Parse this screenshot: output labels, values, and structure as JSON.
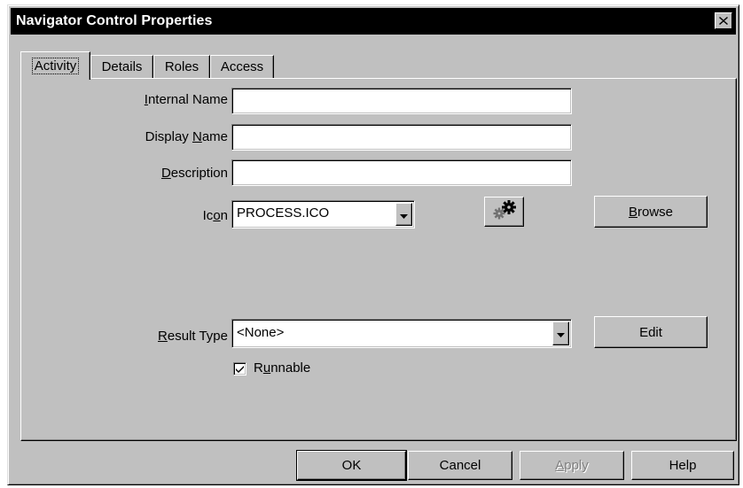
{
  "window": {
    "title": "Navigator Control Properties"
  },
  "tabs": [
    {
      "label": "Activity",
      "active": true
    },
    {
      "label": "Details",
      "active": false
    },
    {
      "label": "Roles",
      "active": false
    },
    {
      "label": "Access",
      "active": false
    }
  ],
  "form": {
    "internal_name": {
      "label": "Internal Name",
      "mnemonic": "I",
      "rest": "nternal Name",
      "value": ""
    },
    "display_name": {
      "label": "Display Name",
      "pre": "Display ",
      "mnemonic": "N",
      "rest": "ame",
      "value": ""
    },
    "description": {
      "label": "Description",
      "mnemonic": "D",
      "rest": "escription",
      "value": ""
    },
    "icon": {
      "label": "Icon",
      "pre": "Ic",
      "mnemonic": "o",
      "rest": "n",
      "value": "PROCESS.ICO"
    },
    "browse_button": {
      "label": "Browse",
      "mnemonic": "B",
      "rest": "rowse"
    },
    "result_type": {
      "label": "Result Type",
      "mnemonic": "R",
      "rest": "esult Type",
      "value": "<None>"
    },
    "edit_button": {
      "label": "Edit"
    },
    "runnable": {
      "label": "Runnable",
      "pre": "R",
      "mnemonic": "u",
      "rest": "nnable",
      "checked": true
    }
  },
  "footer": {
    "ok": "OK",
    "cancel": "Cancel",
    "apply": {
      "label": "Apply",
      "mnemonic": "A",
      "rest": "pply",
      "enabled": false
    },
    "help": "Help"
  },
  "icons": {
    "close": "close-icon",
    "gears": "gears-icon",
    "dropdown": "chevron-down-icon",
    "check": "check-icon"
  }
}
